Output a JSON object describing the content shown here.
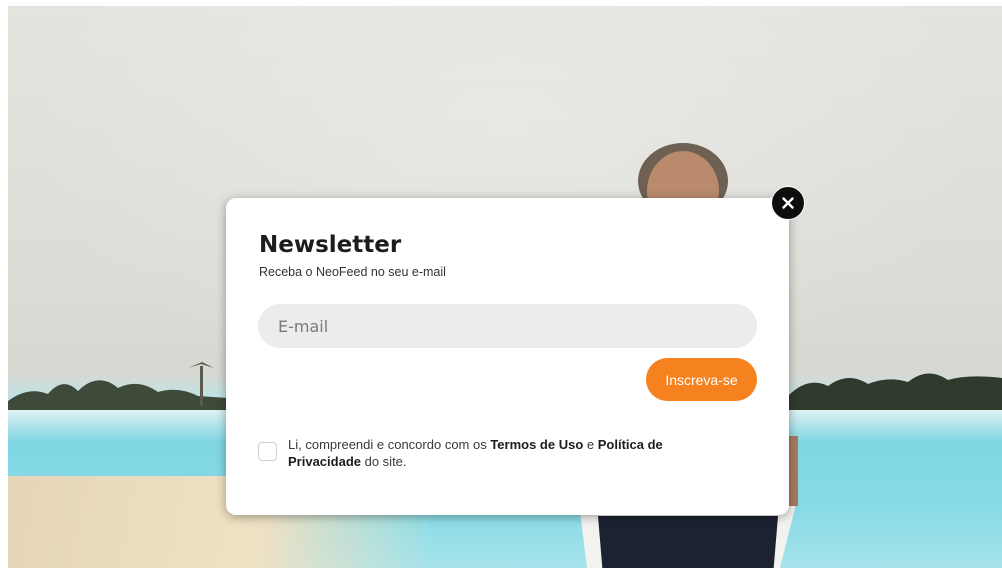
{
  "modal": {
    "title": "Newsletter",
    "subtitle": "Receba o NeoFeed no seu e-mail",
    "email_placeholder": "E-mail",
    "submit_label": "Inscreva-se",
    "consent": {
      "text_before": "Li, compreendi e concordo com os ",
      "terms_link": "Termos de Uso",
      "text_middle": " e ",
      "privacy_link": "Política de Privacidade",
      "text_after": " do site.",
      "checked": false
    }
  },
  "icons": {
    "close": "close-icon"
  },
  "colors": {
    "accent": "#f5821f",
    "close_bg": "#0e0e0e",
    "input_bg": "#ececec"
  }
}
